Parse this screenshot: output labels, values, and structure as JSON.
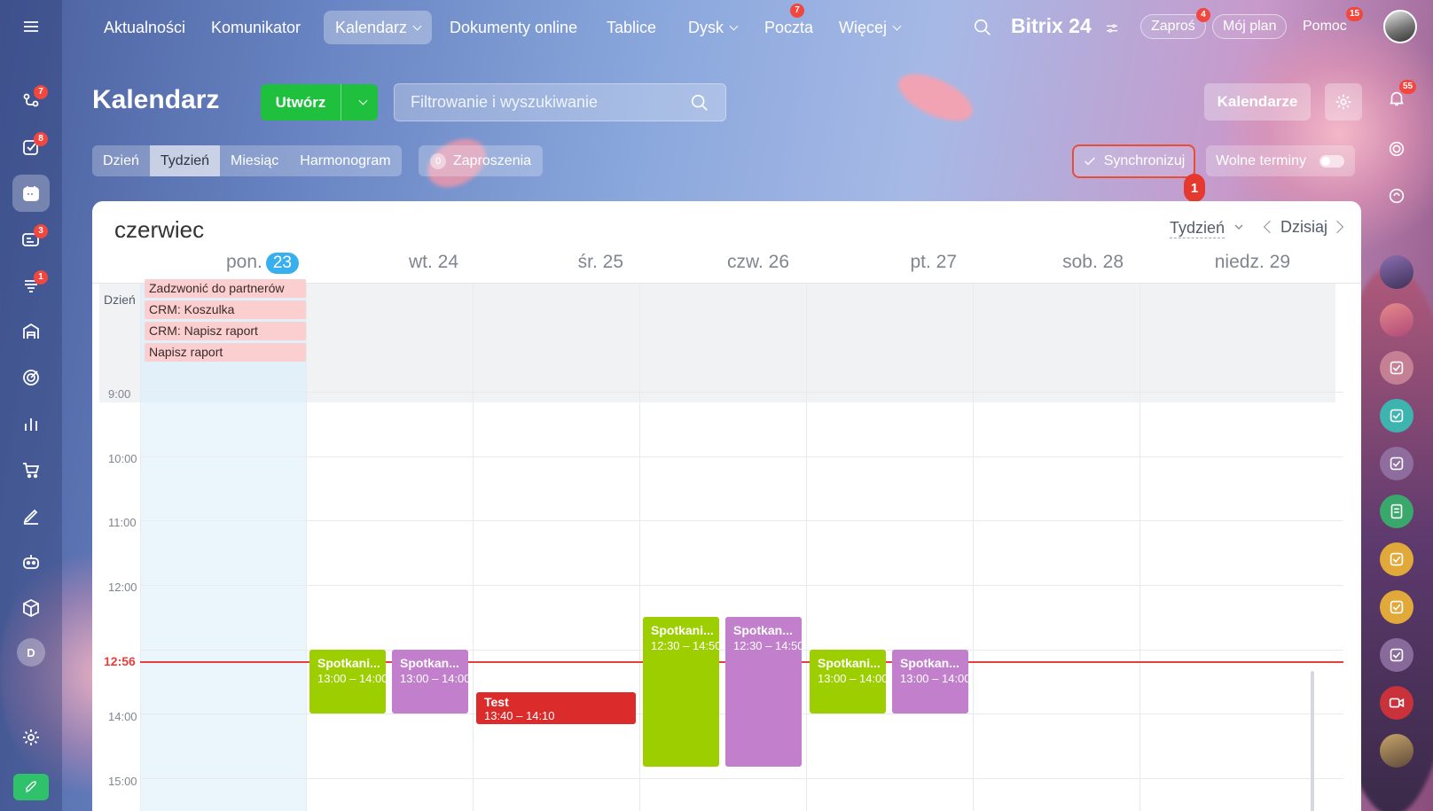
{
  "nav": {
    "items": [
      {
        "label": "Aktualności"
      },
      {
        "label": "Komunikator"
      },
      {
        "label": "Kalendarz",
        "active": true,
        "dropdown": true
      },
      {
        "label": "Dokumenty online"
      },
      {
        "label": "Tablice"
      },
      {
        "label": "Dysk",
        "dropdown": true
      },
      {
        "label": "Poczta",
        "badge": "7"
      },
      {
        "label": "Więcej",
        "dropdown": true
      }
    ],
    "brand": "Bitrix 24",
    "invite": {
      "label": "Zaproś",
      "badge": "4"
    },
    "myplan": "Mój plan",
    "help": {
      "label": "Pomoc",
      "badge": "15"
    }
  },
  "leftbar": {
    "badges": {
      "activity": "7",
      "tasks": "8",
      "crm": "3",
      "feed": "1"
    },
    "user_initial": "D",
    "icons": [
      "menu-icon",
      "activity-icon",
      "tasks-icon",
      "calendar-icon",
      "crm-icon",
      "feed-icon",
      "inventory-icon",
      "goals-icon",
      "analytics-icon",
      "shop-icon",
      "sign-icon",
      "robot-icon",
      "box-icon",
      "user-avatar",
      "settings-icon",
      "rocket-icon"
    ]
  },
  "rightbar": {
    "notifications_badge": "55"
  },
  "header": {
    "title": "Kalendarz",
    "create_label": "Utwórz",
    "search_placeholder": "Filtrowanie i wyszukiwanie",
    "calendars_label": "Kalendarze"
  },
  "views": {
    "tabs": [
      "Dzień",
      "Tydzień",
      "Miesiąc",
      "Harmonogram"
    ],
    "active": "Tydzień"
  },
  "invites": {
    "count": "0",
    "label": "Zaproszenia"
  },
  "sync": {
    "label": "Synchronizuj",
    "marker": "1"
  },
  "free_slots": {
    "label": "Wolne terminy"
  },
  "calendar": {
    "month": "czerwiec",
    "view_select": "Tydzień",
    "today_label": "Dzisiaj",
    "days": [
      {
        "name": "pon.",
        "num": "23",
        "today": true
      },
      {
        "name": "wt.",
        "num": "24"
      },
      {
        "name": "śr.",
        "num": "25"
      },
      {
        "name": "czw.",
        "num": "26"
      },
      {
        "name": "pt.",
        "num": "27"
      },
      {
        "name": "sob.",
        "num": "28"
      },
      {
        "name": "niedz.",
        "num": "29"
      }
    ],
    "allday_label": "Dzień",
    "allday_events": [
      "Zadzwonić do partnerów",
      "CRM: Koszulka",
      "CRM: Napisz raport",
      "Napisz raport"
    ],
    "hours": [
      "9:00",
      "10:00",
      "11:00",
      "12:00",
      "14:00",
      "15:00"
    ],
    "now_label": "12:56",
    "events": [
      {
        "title": "Spotkani...",
        "time": "13:00 – 14:00",
        "color": "green",
        "day": 1,
        "start": "13:00",
        "end": "14:00",
        "slot": 0
      },
      {
        "title": "Spotkan...",
        "time": "13:00 – 14:00",
        "color": "purple",
        "day": 1,
        "start": "13:00",
        "end": "14:00",
        "slot": 1
      },
      {
        "title": "Test",
        "time": "13:40 – 14:10",
        "color": "red",
        "day": 2,
        "start": "13:40",
        "end": "14:10",
        "slot": 0
      },
      {
        "title": "Spotkani...",
        "time": "12:30 – 14:50",
        "color": "green",
        "day": 3,
        "start": "12:30",
        "end": "14:50",
        "slot": 0
      },
      {
        "title": "Spotkan...",
        "time": "12:30 – 14:50",
        "color": "purple",
        "day": 3,
        "start": "12:30",
        "end": "14:50",
        "slot": 1
      },
      {
        "title": "Spotkani...",
        "time": "13:00 – 14:00",
        "color": "green",
        "day": 4,
        "start": "13:00",
        "end": "14:00",
        "slot": 0
      },
      {
        "title": "Spotkan...",
        "time": "13:00 – 14:00",
        "color": "purple",
        "day": 4,
        "start": "13:00",
        "end": "14:00",
        "slot": 1
      }
    ]
  }
}
